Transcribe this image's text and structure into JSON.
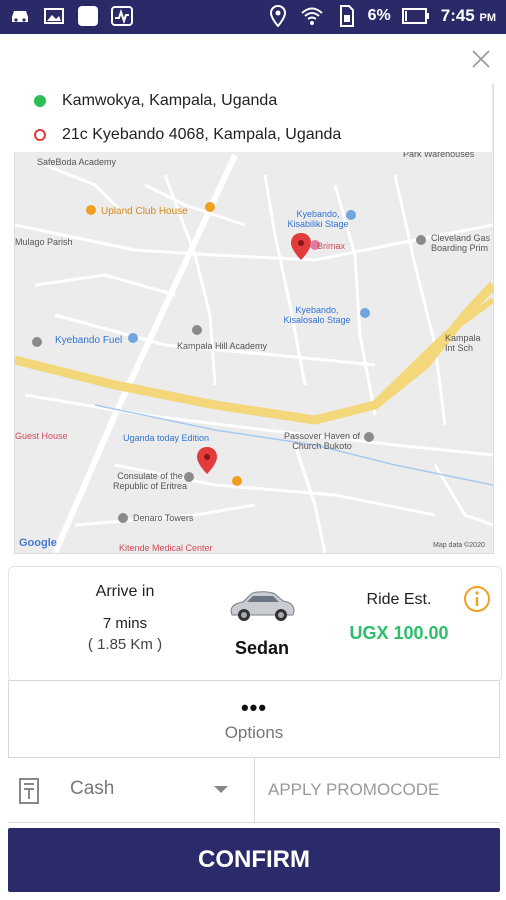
{
  "status_bar": {
    "battery": "6%",
    "time": "7:45",
    "ampm": "PM"
  },
  "locations": {
    "pickup": "Kamwokya, Kampala, Uganda",
    "dropoff": "21c Kyebando 4068, Kampala, Uganda"
  },
  "map": {
    "labels": [
      "SafeBoda Academy",
      "Tirupati Business Park Warehouses",
      "Upland Club House",
      "Kyebando, Kisabiliki Stage",
      "Cleveland Gas Boarding Prim",
      "Mulago Parish",
      "Brimax",
      "Kyebando, Kisalosalo Stage",
      "Kampala Hill Academy",
      "Kampala Int Sch",
      "Kyebando Fuel",
      "Uganda today Edition",
      "Passover Haven of Church Bukoto",
      "Guest House",
      "Consulate of the Republic of Eritrea",
      "Denaro Towers",
      "Kitende Medical Center",
      "Google",
      "Map data ©2020"
    ]
  },
  "ride": {
    "arrive_label": "Arrive in",
    "arrive_time": "7 mins",
    "distance": "( 1.85 Km )",
    "car_type": "Sedan",
    "est_label": "Ride Est.",
    "price": "UGX 100.00"
  },
  "options": {
    "dots": "•••",
    "label": "Options"
  },
  "payment": {
    "method": "Cash",
    "promo_placeholder": "APPLY PROMOCODE"
  },
  "confirm_label": "CONFIRM",
  "colors": {
    "primary": "#2b2b6b",
    "price_green": "#2bbf6a",
    "pickup_dot": "#2bbf55",
    "dropoff_dot": "#e23b3b",
    "info_icon": "#f0a020"
  }
}
